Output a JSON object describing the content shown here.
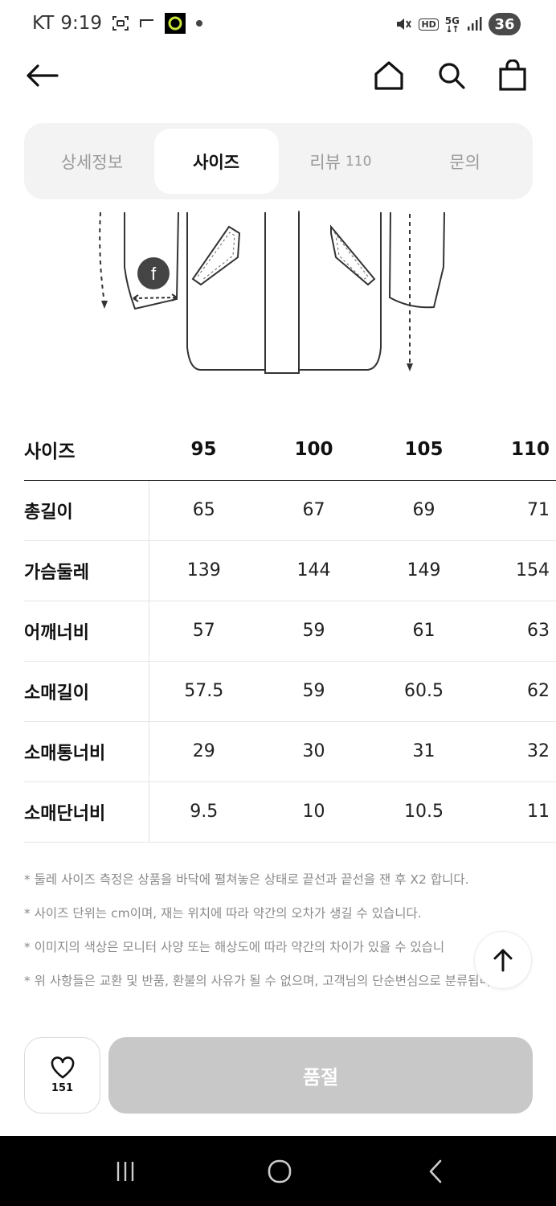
{
  "status_bar": {
    "carrier": "KT",
    "time": "9:19",
    "network": "5G",
    "hd": "HD",
    "battery": "36"
  },
  "nav": {
    "back_icon": "arrow-left-icon",
    "home_icon": "home-icon",
    "search_icon": "search-icon",
    "bag_icon": "shopping-bag-icon"
  },
  "tabs": [
    {
      "label": "상세정보",
      "count": "",
      "active": false
    },
    {
      "label": "사이즈",
      "count": "",
      "active": true
    },
    {
      "label": "리뷰",
      "count": "110",
      "active": false
    },
    {
      "label": "문의",
      "count": "",
      "active": false
    }
  ],
  "illustration": {
    "marker_label": "f"
  },
  "size_table": {
    "header_label": "사이즈",
    "sizes": [
      "95",
      "100",
      "105",
      "110"
    ],
    "rows": [
      {
        "label": "총길이",
        "values": [
          "65",
          "67",
          "69",
          "71"
        ]
      },
      {
        "label": "가슴둘레",
        "values": [
          "139",
          "144",
          "149",
          "154"
        ]
      },
      {
        "label": "어깨너비",
        "values": [
          "57",
          "59",
          "61",
          "63"
        ]
      },
      {
        "label": "소매길이",
        "values": [
          "57.5",
          "59",
          "60.5",
          "62"
        ]
      },
      {
        "label": "소매통너비",
        "values": [
          "29",
          "30",
          "31",
          "32"
        ]
      },
      {
        "label": "소매단너비",
        "values": [
          "9.5",
          "10",
          "10.5",
          "11"
        ]
      }
    ]
  },
  "notes": [
    "* 둘레 사이즈 측정은 상품을 바닥에 펼쳐놓은 상태로 끝선과 끝선을 잰 후 X2 합니다.",
    "* 사이즈 단위는 cm이며, 재는 위치에 따라 약간의 오차가 생길 수 있습니다.",
    "* 이미지의 색상은 모니터 사양 또는 해상도에 따라 약간의 차이가 있을 수 있습니",
    "* 위 사항들은 교환 및 반품, 환불의 사유가 될 수 없으며, 고객님의 단순변심으로 분류됩니다."
  ],
  "like": {
    "count": "151"
  },
  "purchase": {
    "label": "품절"
  },
  "colors": {
    "tab_bg": "#f3f3f4",
    "disabled_button": "#c8c8c8",
    "system_nav": "#000000"
  }
}
